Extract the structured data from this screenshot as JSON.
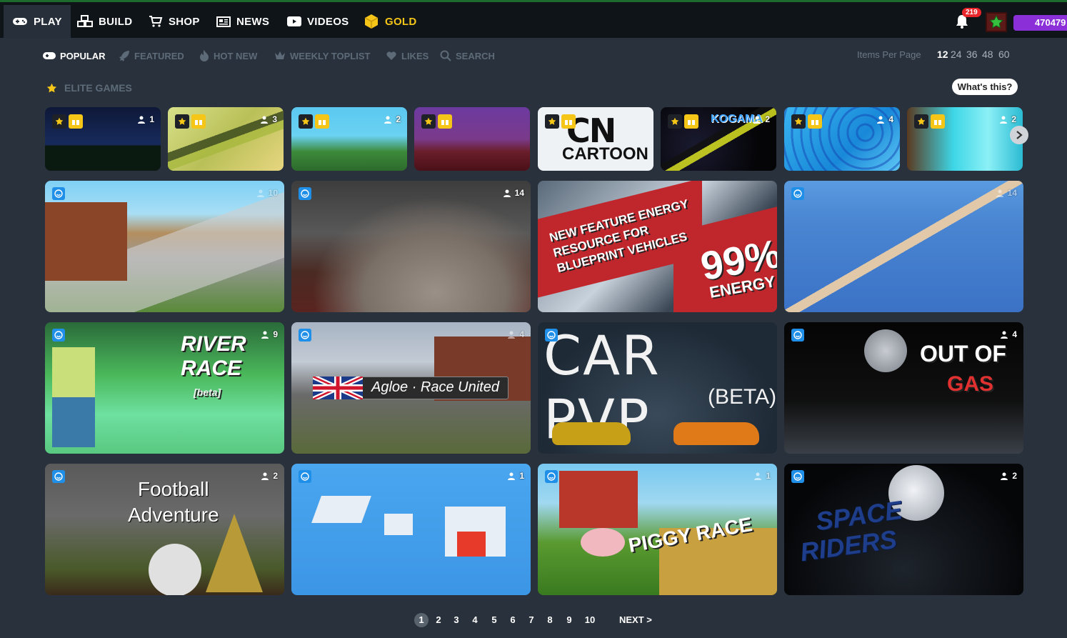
{
  "topnav": {
    "items": [
      {
        "label": "PLAY",
        "icon": "gamepad-icon"
      },
      {
        "label": "BUILD",
        "icon": "blocks-icon"
      },
      {
        "label": "SHOP",
        "icon": "cart-icon"
      },
      {
        "label": "NEWS",
        "icon": "newspaper-icon"
      },
      {
        "label": "VIDEOS",
        "icon": "play-icon"
      },
      {
        "label": "GOLD",
        "icon": "gold-cube-icon"
      }
    ],
    "notifications": "219",
    "points": "470479"
  },
  "subnav": {
    "items": [
      {
        "label": "POPULAR",
        "icon": "gamepad-icon"
      },
      {
        "label": "FEATURED",
        "icon": "rocket-icon"
      },
      {
        "label": "HOT NEW",
        "icon": "flame-icon"
      },
      {
        "label": "WEEKLY TOPLIST",
        "icon": "crown-icon"
      },
      {
        "label": "LIKES",
        "icon": "heart-icon"
      },
      {
        "label": "SEARCH",
        "icon": "search-icon"
      }
    ],
    "items_per_page_label": "Items Per Page",
    "items_per_page": [
      "12",
      "24",
      "36",
      "48",
      "60"
    ]
  },
  "elite": {
    "label": "ELITE GAMES",
    "whats_this": "What's this?"
  },
  "elite_games": [
    {
      "players": "1"
    },
    {
      "players": "3"
    },
    {
      "players": "2"
    },
    {
      "players": ""
    },
    {
      "players": "",
      "title": "CARTOON"
    },
    {
      "players": "2",
      "title": "KOGAMA"
    },
    {
      "players": "4"
    },
    {
      "players": "2"
    }
  ],
  "games": [
    {
      "players": "10",
      "title": ""
    },
    {
      "players": "14",
      "title": ""
    },
    {
      "players": "",
      "title": "NEW FEATURE ENERGY RESOURCE FOR BLUEPRINT VEHICLES",
      "energy": "99%",
      "energy_label": "ENERGY"
    },
    {
      "players": "14",
      "title": ""
    },
    {
      "players": "9",
      "title": "RIVER RACE",
      "subtitle": "[beta]"
    },
    {
      "players": "4",
      "title": "Agloe · Race United"
    },
    {
      "players": "",
      "title": "CAR PVP",
      "subtitle": "(BETA)"
    },
    {
      "players": "4",
      "title": "OUT OF",
      "subtitle": "GAS"
    },
    {
      "players": "2",
      "title": "Football",
      "subtitle": "Adventure"
    },
    {
      "players": "1",
      "title": ""
    },
    {
      "players": "1",
      "title": "PIGGY RACE"
    },
    {
      "players": "2",
      "title": "SPACE",
      "subtitle": "RIDERS"
    }
  ],
  "pagination": {
    "pages": [
      "1",
      "2",
      "3",
      "4",
      "5",
      "6",
      "7",
      "8",
      "9",
      "10"
    ],
    "next": "NEXT >"
  }
}
